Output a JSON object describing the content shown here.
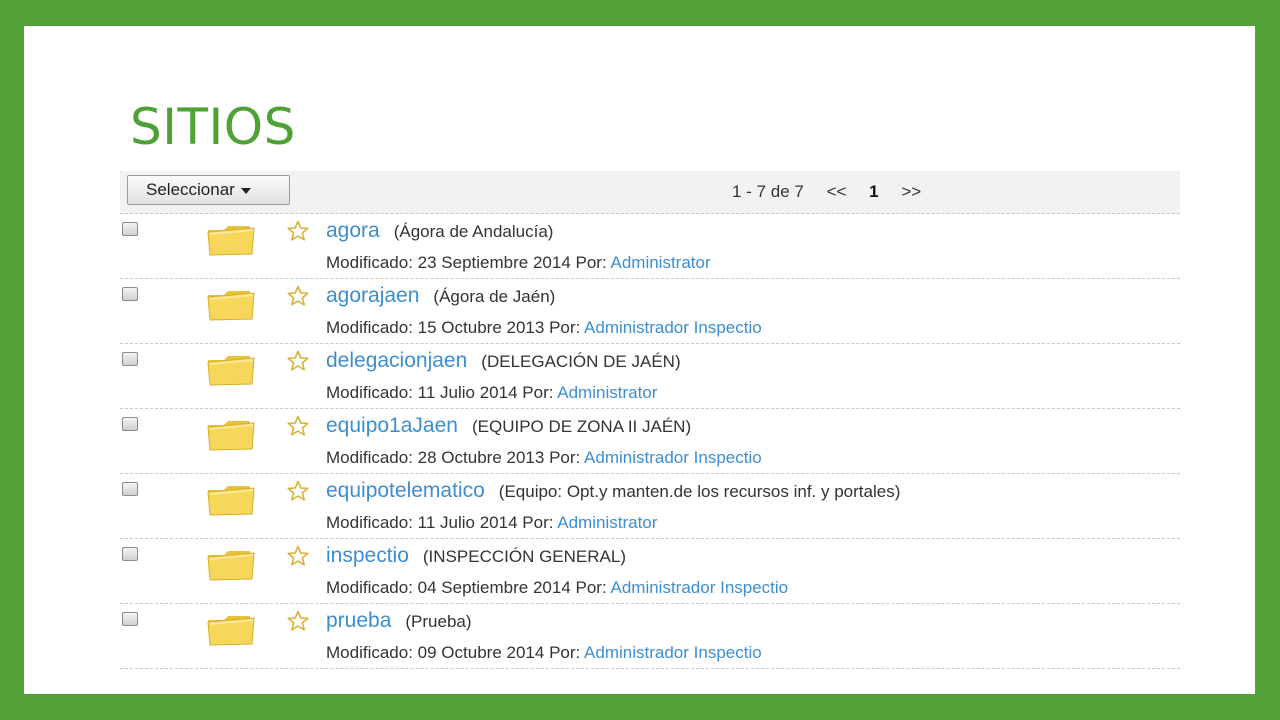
{
  "title": "SITIOS",
  "toolbar": {
    "select_label": "Seleccionar",
    "range": "1 - 7 de 7",
    "prev": "<<",
    "page": "1",
    "next": ">>"
  },
  "labels": {
    "modified": "Modificado:",
    "by": "Por:"
  },
  "sites": [
    {
      "name": "agora",
      "desc": "(Ágora de Andalucía)",
      "date": "23 Septiembre 2014",
      "author": "Administrator"
    },
    {
      "name": "agorajaen",
      "desc": "(Ágora de Jaén)",
      "date": "15 Octubre 2013",
      "author": "Administrador Inspectio"
    },
    {
      "name": "delegacionjaen",
      "desc": "(DELEGACIÓN DE JAÉN)",
      "date": "11 Julio 2014",
      "author": "Administrator"
    },
    {
      "name": "equipo1aJaen",
      "desc": "(EQUIPO DE ZONA II JAÉN)",
      "date": "28 Octubre 2013",
      "author": "Administrador Inspectio"
    },
    {
      "name": "equipotelematico",
      "desc": "(Equipo: Opt.y manten.de los recursos inf. y portales)",
      "date": "11 Julio 2014",
      "author": "Administrator"
    },
    {
      "name": "inspectio",
      "desc": "(INSPECCIÓN GENERAL)",
      "date": "04 Septiembre 2014",
      "author": "Administrador Inspectio"
    },
    {
      "name": "prueba",
      "desc": "(Prueba)",
      "date": "09 Octubre 2014",
      "author": "Administrador Inspectio"
    }
  ],
  "colors": {
    "frame": "#51a038",
    "title": "#4ea235",
    "link": "#3d8ed0",
    "folder": "#f7d75a"
  },
  "icons": {
    "folder": "folder-icon",
    "star": "star-outline-icon",
    "checkbox": "checkbox",
    "caret": "caret-down-icon"
  }
}
